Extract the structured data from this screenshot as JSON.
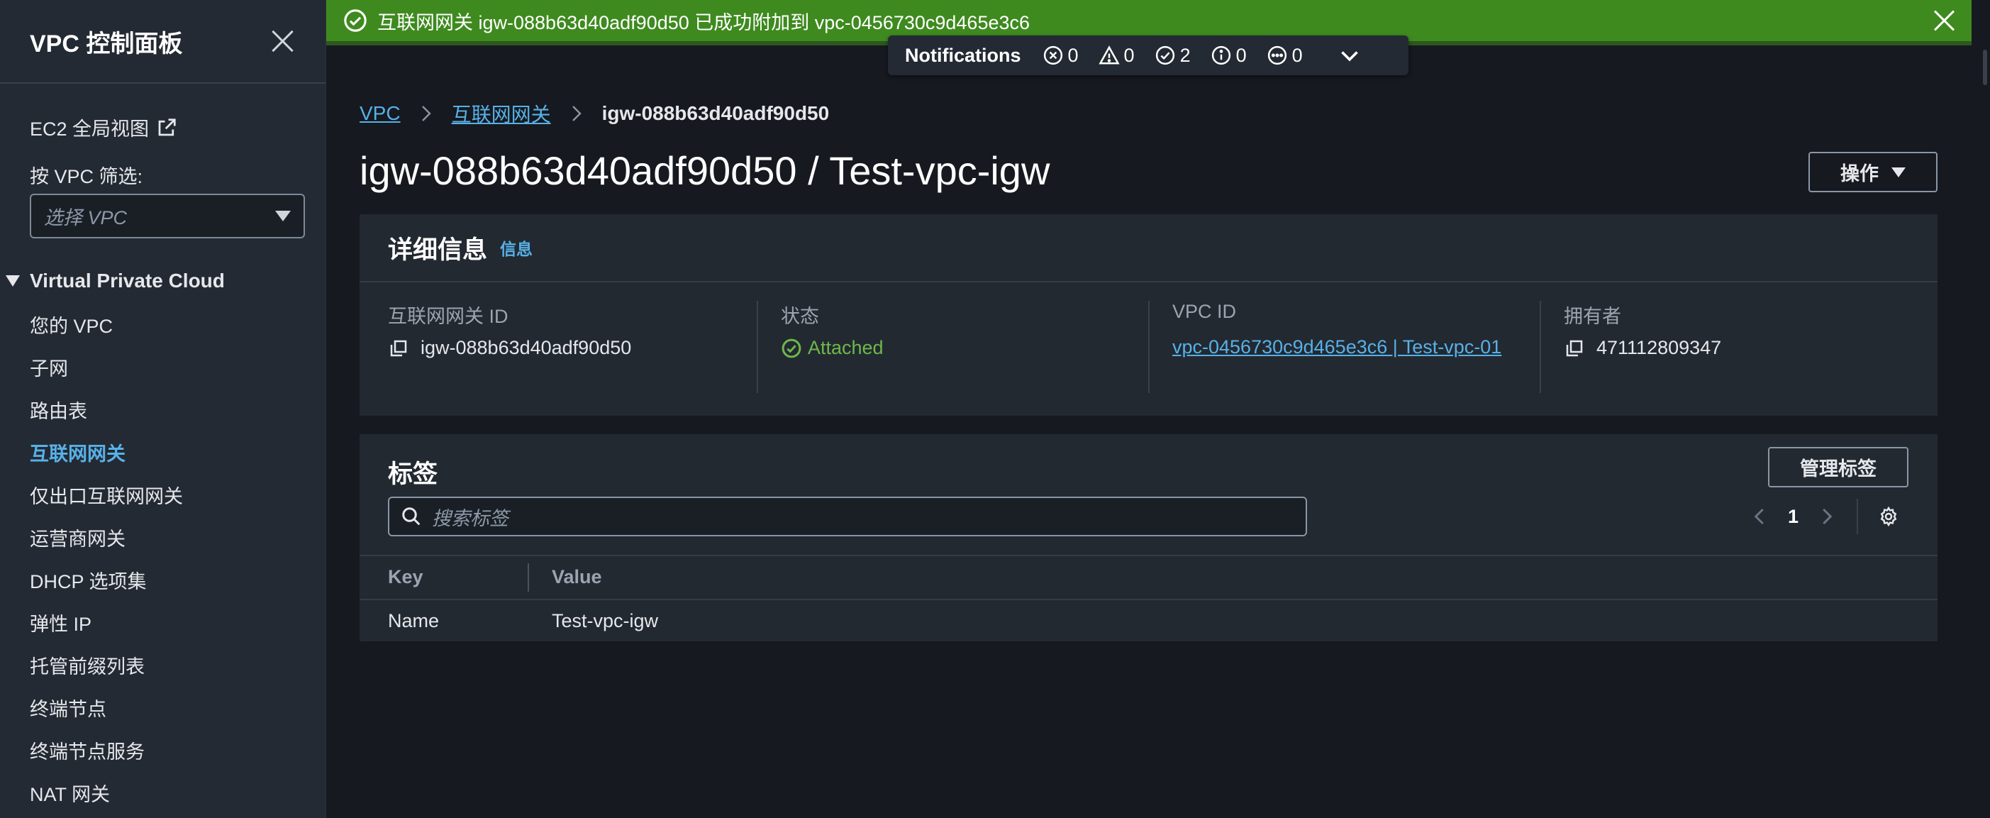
{
  "sidebar": {
    "title": "VPC 控制面板",
    "ec2_link": "EC2 全局视图",
    "filter_label": "按 VPC 筛选:",
    "filter_placeholder": "选择 VPC",
    "section": "Virtual Private Cloud",
    "items": [
      {
        "label": "您的 VPC"
      },
      {
        "label": "子网"
      },
      {
        "label": "路由表"
      },
      {
        "label": "互联网网关",
        "active": true
      },
      {
        "label": "仅出口互联网网关"
      },
      {
        "label": "运营商网关"
      },
      {
        "label": "DHCP 选项集"
      },
      {
        "label": "弹性 IP"
      },
      {
        "label": "托管前缀列表"
      },
      {
        "label": "终端节点"
      },
      {
        "label": "终端节点服务"
      },
      {
        "label": "NAT 网关"
      }
    ]
  },
  "flash": {
    "message": "互联网网关 igw-088b63d40adf90d50 已成功附加到 vpc-0456730c9d465e3c6",
    "color": "#3e8a1f"
  },
  "notifications": {
    "label": "Notifications",
    "error": "0",
    "warning": "0",
    "success": "2",
    "info": "0",
    "in_progress": "0"
  },
  "breadcrumb": {
    "root": "VPC",
    "parent": "互联网网关",
    "current": "igw-088b63d40adf90d50"
  },
  "page": {
    "title": "igw-088b63d40adf90d50 / Test-vpc-igw",
    "actions_label": "操作"
  },
  "details": {
    "title": "详细信息",
    "info_link": "信息",
    "igw_id_label": "互联网网关 ID",
    "igw_id": "igw-088b63d40adf90d50",
    "state_label": "状态",
    "state": "Attached",
    "vpc_label": "VPC ID",
    "vpc_link": "vpc-0456730c9d465e3c6 | Test-vpc-01",
    "owner_label": "拥有者",
    "owner": "471112809347"
  },
  "tags": {
    "title": "标签",
    "manage_label": "管理标签",
    "search_placeholder": "搜索标签",
    "page": "1",
    "columns": [
      "Key",
      "Value"
    ],
    "rows": [
      {
        "key": "Name",
        "value": "Test-vpc-igw"
      }
    ]
  },
  "colors": {
    "accent": "#57b1e8",
    "success": "#6eb84a",
    "background": "#16191f"
  }
}
